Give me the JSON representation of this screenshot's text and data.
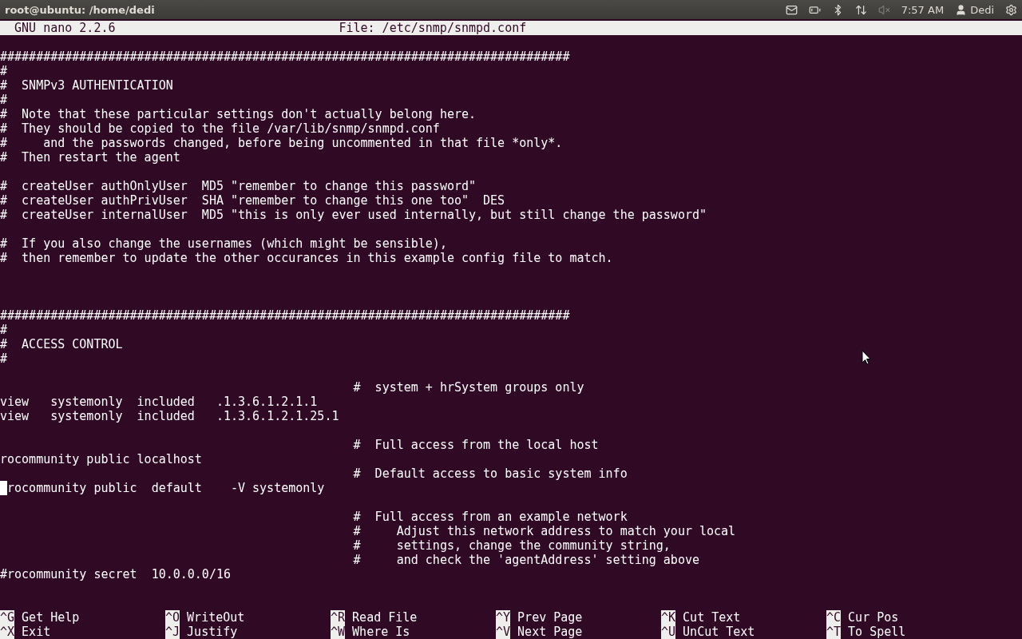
{
  "top_panel": {
    "title": "root@ubuntu: /home/dedi",
    "clock": "7:57 AM",
    "user": "Dedi",
    "sound_muted": true
  },
  "nano_header": {
    "version": "GNU nano 2.2.6",
    "file": "File: /etc/snmp/snmpd.conf"
  },
  "lines": [
    {
      "kind": "text",
      "text": "###############################################################################"
    },
    {
      "kind": "text",
      "text": "#"
    },
    {
      "kind": "text",
      "text": "#  SNMPv3 AUTHENTICATION"
    },
    {
      "kind": "text",
      "text": "#"
    },
    {
      "kind": "text",
      "text": "#  Note that these particular settings don't actually belong here."
    },
    {
      "kind": "text",
      "text": "#  They should be copied to the file /var/lib/snmp/snmpd.conf"
    },
    {
      "kind": "text",
      "text": "#     and the passwords changed, before being uncommented in that file *only*."
    },
    {
      "kind": "text",
      "text": "#  Then restart the agent"
    },
    {
      "kind": "blank"
    },
    {
      "kind": "text",
      "text": "#  createUser authOnlyUser  MD5 \"remember to change this password\""
    },
    {
      "kind": "text",
      "text": "#  createUser authPrivUser  SHA \"remember to change this one too\"  DES"
    },
    {
      "kind": "text",
      "text": "#  createUser internalUser  MD5 \"this is only ever used internally, but still change the password\""
    },
    {
      "kind": "blank"
    },
    {
      "kind": "text",
      "text": "#  If you also change the usernames (which might be sensible),"
    },
    {
      "kind": "text",
      "text": "#  then remember to update the other occurances in this example config file to match."
    },
    {
      "kind": "blank"
    },
    {
      "kind": "blank"
    },
    {
      "kind": "blank"
    },
    {
      "kind": "text",
      "text": "###############################################################################"
    },
    {
      "kind": "text",
      "text": "#"
    },
    {
      "kind": "text",
      "text": "#  ACCESS CONTROL"
    },
    {
      "kind": "text",
      "text": "#"
    },
    {
      "kind": "blank"
    },
    {
      "kind": "text",
      "text": "                                                 #  system + hrSystem groups only"
    },
    {
      "kind": "text",
      "text": "view   systemonly  included   .1.3.6.1.2.1.1"
    },
    {
      "kind": "text",
      "text": "view   systemonly  included   .1.3.6.1.2.1.25.1"
    },
    {
      "kind": "blank"
    },
    {
      "kind": "text",
      "text": "                                                 #  Full access from the local host"
    },
    {
      "kind": "text",
      "text": "rocommunity public localhost"
    },
    {
      "kind": "text",
      "text": "                                                 #  Default access to basic system info"
    },
    {
      "kind": "cursor",
      "text": "rocommunity public  default    -V systemonly"
    },
    {
      "kind": "blank"
    },
    {
      "kind": "text",
      "text": "                                                 #  Full access from an example network"
    },
    {
      "kind": "text",
      "text": "                                                 #     Adjust this network address to match your local"
    },
    {
      "kind": "text",
      "text": "                                                 #     settings, change the community string,"
    },
    {
      "kind": "text",
      "text": "                                                 #     and check the 'agentAddress' setting above"
    },
    {
      "kind": "text",
      "text": "#rocommunity secret  10.0.0.0/16"
    },
    {
      "kind": "blank"
    },
    {
      "kind": "blank"
    }
  ],
  "shortcuts": [
    {
      "key": "^G",
      "label": "Get Help"
    },
    {
      "key": "^O",
      "label": "WriteOut"
    },
    {
      "key": "^R",
      "label": "Read File"
    },
    {
      "key": "^Y",
      "label": "Prev Page"
    },
    {
      "key": "^K",
      "label": "Cut Text"
    },
    {
      "key": "^C",
      "label": "Cur Pos"
    },
    {
      "key": "^X",
      "label": "Exit"
    },
    {
      "key": "^J",
      "label": "Justify"
    },
    {
      "key": "^W",
      "label": "Where Is"
    },
    {
      "key": "^V",
      "label": "Next Page"
    },
    {
      "key": "^U",
      "label": "UnCut Text"
    },
    {
      "key": "^T",
      "label": "To Spell"
    }
  ]
}
